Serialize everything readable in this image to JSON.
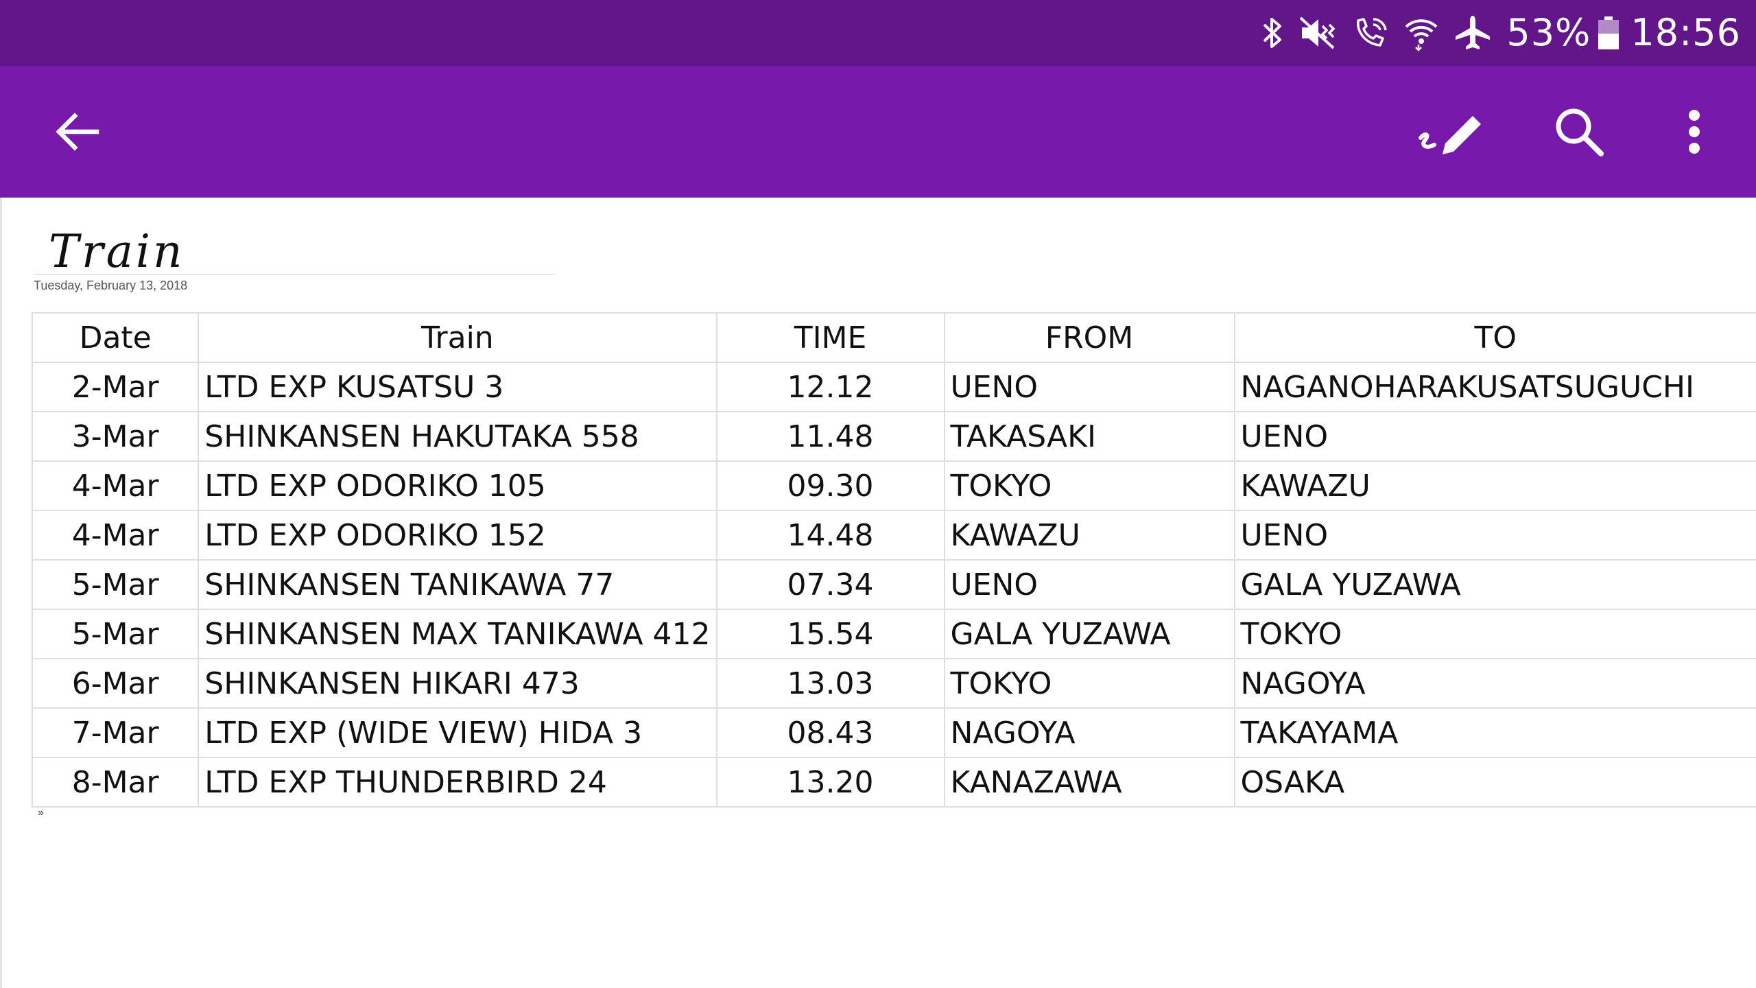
{
  "status_bar": {
    "battery": "53%",
    "time": "18:56",
    "icons": [
      "bluetooth-icon",
      "vibrate-mute-icon",
      "wifi-calling-icon",
      "wifi-icon",
      "airplane-icon",
      "battery-icon"
    ]
  },
  "app_bar": {
    "icons": [
      "back-arrow-icon",
      "draw-pen-icon",
      "search-icon",
      "more-vert-icon"
    ],
    "color": "#7719aa",
    "status_color": "#62168a"
  },
  "note": {
    "title": "Train",
    "date": "Tuesday, February 13, 2018",
    "footnote": "»"
  },
  "table": {
    "headers": [
      "Date",
      "Train",
      "TIME",
      "FROM",
      "TO"
    ],
    "rows": [
      [
        "2-Mar",
        "LTD EXP KUSATSU 3",
        "12.12",
        "UENO",
        "NAGANOHARAKUSATSUGUCHI"
      ],
      [
        "3-Mar",
        "SHINKANSEN HAKUTAKA 558",
        "11.48",
        "TAKASAKI",
        "UENO"
      ],
      [
        "4-Mar",
        "LTD EXP ODORIKO 105",
        "09.30",
        "TOKYO",
        "KAWAZU"
      ],
      [
        "4-Mar",
        "LTD EXP ODORIKO 152",
        "14.48",
        "KAWAZU",
        "UENO"
      ],
      [
        "5-Mar",
        "SHINKANSEN TANIKAWA 77",
        "07.34",
        "UENO",
        "GALA YUZAWA"
      ],
      [
        "5-Mar",
        "SHINKANSEN MAX TANIKAWA 412",
        "15.54",
        "GALA YUZAWA",
        "TOKYO"
      ],
      [
        "6-Mar",
        "SHINKANSEN HIKARI 473",
        "13.03",
        "TOKYO",
        "NAGOYA"
      ],
      [
        "7-Mar",
        "LTD EXP (WIDE VIEW) HIDA 3",
        "08.43",
        "NAGOYA",
        "TAKAYAMA"
      ],
      [
        "8-Mar",
        "LTD EXP THUNDERBIRD 24",
        "13.20",
        "KANAZAWA",
        "OSAKA"
      ]
    ]
  }
}
